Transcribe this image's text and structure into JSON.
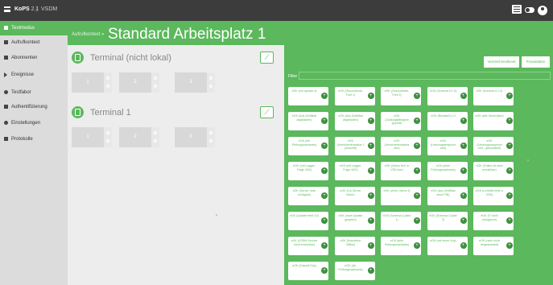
{
  "topbar": {
    "brand": "KoPS",
    "version": " 2.1",
    "separator": "|",
    "context": "VSDM",
    "menu_icon": "hamburger-icon",
    "toggle_icon": "toggle-icon",
    "user_icon": "user-icon"
  },
  "sidebar": {
    "items": [
      {
        "label": "Testmodus",
        "icon": "mode-icon",
        "active": true
      },
      {
        "label": "Aufrufkontext",
        "icon": "context-icon"
      },
      {
        "label": "Abonnenten",
        "icon": "subscribers-icon"
      },
      {
        "label": "Ereignisse",
        "icon": "events-icon"
      },
      {
        "label": "Testfabor",
        "icon": "lab-icon"
      },
      {
        "label": "Authentifizierung",
        "icon": "auth-icon"
      },
      {
        "label": "Einstellungen",
        "icon": "settings-icon"
      },
      {
        "label": "Protokolle",
        "icon": "logs-icon"
      }
    ]
  },
  "header": {
    "breadcrumb": "Aufrufkontext",
    "separator": "»",
    "title": "Standard Arbeitsplatz 1"
  },
  "terminals": [
    {
      "name": "Terminal (nicht lokal)",
      "link_icon": "plug-icon",
      "slots": [
        "1",
        "2",
        "3"
      ]
    },
    {
      "name": "Terminal 1",
      "link_icon": "plug-icon",
      "slots": [
        "1",
        "2",
        "3"
      ]
    }
  ],
  "events_panel": {
    "tabs": [
      "Verzeichnisdienst",
      "Praxisdaten"
    ],
    "filter_label": "Filter",
    "filter_value": "",
    "add_icon": "add-circle-icon",
    "events": [
      "eGK (mit Update d)",
      "eGK (Gesundheits-Fonf 1)",
      "eGK (Gesundheits-Fonf 2)",
      "eGK (Schema 5.1.0)",
      "eGK (Schema 5.1.0)",
      "eGK (Aus Zertifikat abgelaufen)",
      "eGK (Aus Zertifikat abgelaufen)",
      "eGK (Zahlungsfähigkeit geprüft)",
      "eGK (Blockiert) 1.0",
      "eGK (alte Generation)",
      "eGK (mit Prüfungsnachweis)",
      "eGK (Versichertenstatus 1 (Zukunft))",
      "eGK (Versichertenstatus leer)",
      "eGK (Leistungsanspruch ruht)",
      "eGK (Leistungsanspruch ruht - geschränkt)",
      "eGK (mit Logger, Folge 4OK)",
      "eGK (mit Logger, Folge 4OK)",
      "eGK (Zeilen fehl. in VSD leer)",
      "eGK (ohne Prüfungsnachweis)",
      "eGK (Online ist nicht erreichbar)",
      "eGK (Server hoch verfügbar)",
      "eGK (CA-Server fehler)",
      "eGK (ohne Lizenz 4)",
      "eGK (Aus Zertifikat ohne PIN)",
      "eGK (Lichtbild fehlt in VSD)",
      "eGK (Update fehlt 3.0)",
      "eGK (nach Update gesperrt)",
      "eGK (Schema 3 plain 1)",
      "eGK (Schema 3 plain 2)",
      "eGK (TI nicht erfolgreich)",
      "eGK (VSDM Service nicht erreichbar)",
      "eGK (Konnektor Offline)",
      "eGK (aller Prüfungsnachweis)",
      "eGK (mit neuer Key)",
      "eGK (nach nicht freigeschaltet)",
      "eGK (Zukunft Key)",
      "eGK (alt. Prüfungsnachweis)"
    ]
  }
}
